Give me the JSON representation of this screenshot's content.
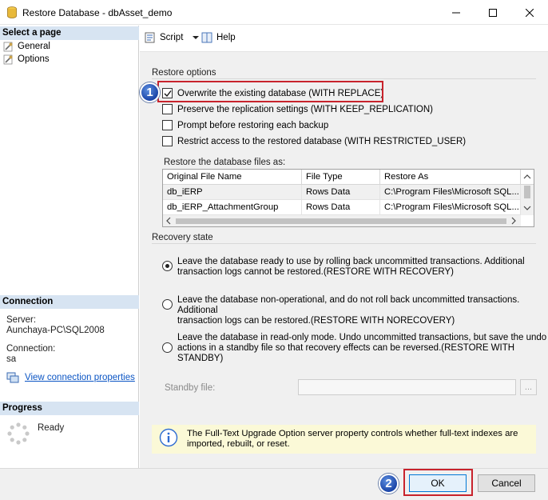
{
  "window": {
    "title": "Restore Database - dbAsset_demo",
    "icon": "database-icon"
  },
  "left": {
    "select_page": "Select a page",
    "pages": [
      {
        "label": "General",
        "icon": "wrench-icon"
      },
      {
        "label": "Options",
        "icon": "wrench-icon"
      }
    ],
    "connection": {
      "header": "Connection",
      "server_label": "Server:",
      "server_value": "Aunchaya-PC\\SQL2008",
      "connection_label": "Connection:",
      "connection_value": "sa",
      "view_link": "View connection properties"
    },
    "progress": {
      "header": "Progress",
      "status": "Ready"
    }
  },
  "toolbar": {
    "script": "Script",
    "help": "Help"
  },
  "restore_options": {
    "label": "Restore options",
    "options": [
      {
        "label": "Overwrite the existing database (WITH REPLACE)",
        "checked": true
      },
      {
        "label": "Preserve the replication settings (WITH KEEP_REPLICATION)",
        "checked": false
      },
      {
        "label": "Prompt before restoring each backup",
        "checked": false
      },
      {
        "label": "Restrict access to the restored database (WITH RESTRICTED_USER)",
        "checked": false
      }
    ],
    "files_label": "Restore the database files as:",
    "columns": [
      "Original File Name",
      "File Type",
      "Restore As"
    ],
    "rows": [
      [
        "db_iERP",
        "Rows Data",
        "C:\\Program Files\\Microsoft SQL..."
      ],
      [
        "db_iERP_AttachmentGroup",
        "Rows Data",
        "C:\\Program Files\\Microsoft SQL..."
      ]
    ]
  },
  "recovery": {
    "label": "Recovery state",
    "options": [
      {
        "line1": "Leave the database ready to use by rolling back uncommitted transactions. Additional",
        "line2": "transaction logs cannot be restored.(RESTORE WITH RECOVERY)",
        "line3": "",
        "selected": true
      },
      {
        "line1": "Leave the database non-operational, and do not roll back uncommitted transactions. Additional",
        "line2": "transaction logs can be restored.(RESTORE WITH NORECOVERY)",
        "line3": "",
        "selected": false
      },
      {
        "line1": "Leave the database in read-only mode. Undo uncommitted transactions, but save the undo",
        "line2": "actions in a standby file so that recovery effects can be reversed.(RESTORE WITH",
        "line3": "STANDBY)",
        "selected": false
      }
    ],
    "standby_label": "Standby file:",
    "standby_value": "",
    "browse": "..."
  },
  "info": {
    "line1": "The Full-Text Upgrade Option server property controls whether full-text indexes are",
    "line2": "imported, rebuilt, or reset."
  },
  "buttons": {
    "ok": "OK",
    "cancel": "Cancel"
  },
  "badges": [
    "1",
    "2"
  ],
  "colors": {
    "highlight_red": "#c8232c",
    "badge_blue": "#1b45a8",
    "section_header": "#d7e4f2",
    "link_blue": "#0b55c4"
  }
}
